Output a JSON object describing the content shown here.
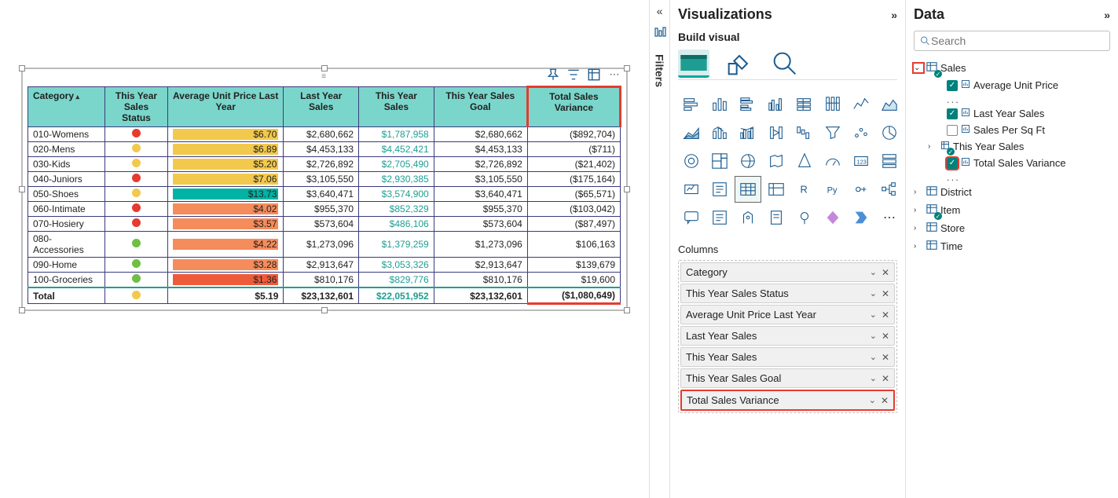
{
  "panes": {
    "filters_label": "Filters",
    "visualizations_title": "Visualizations",
    "build_visual": "Build visual",
    "columns_section": "Columns",
    "data_title": "Data",
    "search_placeholder": "Search"
  },
  "table": {
    "headers": [
      "Category",
      "This Year Sales Status",
      "Average Unit Price Last Year",
      "Last Year Sales",
      "This Year Sales",
      "This Year Sales Goal",
      "Total Sales Variance"
    ],
    "rows": [
      {
        "cat": "010-Womens",
        "status": "red",
        "priceColor": "#f2c94c",
        "price": "$6.70",
        "ly": "$2,680,662",
        "ty": "$1,787,958",
        "goal": "$2,680,662",
        "var": "($892,704)"
      },
      {
        "cat": "020-Mens",
        "status": "yellow",
        "priceColor": "#f2c94c",
        "price": "$6.89",
        "ly": "$4,453,133",
        "ty": "$4,452,421",
        "goal": "$4,453,133",
        "var": "($711)"
      },
      {
        "cat": "030-Kids",
        "status": "yellow",
        "priceColor": "#f2c94c",
        "price": "$5.20",
        "ly": "$2,726,892",
        "ty": "$2,705,490",
        "goal": "$2,726,892",
        "var": "($21,402)"
      },
      {
        "cat": "040-Juniors",
        "status": "red",
        "priceColor": "#f2c94c",
        "price": "$7.06",
        "ly": "$3,105,550",
        "ty": "$2,930,385",
        "goal": "$3,105,550",
        "var": "($175,164)"
      },
      {
        "cat": "050-Shoes",
        "status": "yellow",
        "priceColor": "#00b3a4",
        "price": "$13.73",
        "ly": "$3,640,471",
        "ty": "$3,574,900",
        "goal": "$3,640,471",
        "var": "($65,571)"
      },
      {
        "cat": "060-Intimate",
        "status": "red",
        "priceColor": "#f58c5b",
        "price": "$4.02",
        "ly": "$955,370",
        "ty": "$852,329",
        "goal": "$955,370",
        "var": "($103,042)"
      },
      {
        "cat": "070-Hosiery",
        "status": "red",
        "priceColor": "#f58c5b",
        "price": "$3.57",
        "ly": "$573,604",
        "ty": "$486,106",
        "goal": "$573,604",
        "var": "($87,497)"
      },
      {
        "cat": "080-Accessories",
        "status": "green",
        "priceColor": "#f58c5b",
        "price": "$4.22",
        "ly": "$1,273,096",
        "ty": "$1,379,259",
        "goal": "$1,273,096",
        "var": "$106,163"
      },
      {
        "cat": "090-Home",
        "status": "green",
        "priceColor": "#f58c5b",
        "price": "$3.28",
        "ly": "$2,913,647",
        "ty": "$3,053,326",
        "goal": "$2,913,647",
        "var": "$139,679"
      },
      {
        "cat": "100-Groceries",
        "status": "green",
        "priceColor": "#ee5b3a",
        "price": "$1.36",
        "ly": "$810,176",
        "ty": "$829,776",
        "goal": "$810,176",
        "var": "$19,600"
      }
    ],
    "total": {
      "label": "Total",
      "status": "yellow",
      "price": "$5.19",
      "ly": "$23,132,601",
      "ty": "$22,051,952",
      "goal": "$23,132,601",
      "var": "($1,080,649)"
    }
  },
  "columns_well": [
    {
      "label": "Category",
      "hl": false
    },
    {
      "label": "This Year Sales Status",
      "hl": false
    },
    {
      "label": "Average Unit Price Last Year",
      "hl": false
    },
    {
      "label": "Last Year Sales",
      "hl": false
    },
    {
      "label": "This Year Sales",
      "hl": false
    },
    {
      "label": "This Year Sales Goal",
      "hl": false
    },
    {
      "label": "Total Sales Variance",
      "hl": true
    }
  ],
  "fields": {
    "sales_table": "Sales",
    "avg_unit": "Average Unit Price",
    "ellipsis": "...",
    "last_year": "Last Year Sales",
    "per_sqft": "Sales Per Sq Ft",
    "this_year": "This Year Sales",
    "total_var": "Total Sales Variance",
    "district": "District",
    "item": "Item",
    "store": "Store",
    "time": "Time"
  },
  "chart_data": {
    "type": "table",
    "title": "Sales by Category",
    "columns": [
      "Category",
      "This Year Sales Status",
      "Average Unit Price Last Year",
      "Last Year Sales",
      "This Year Sales",
      "This Year Sales Goal",
      "Total Sales Variance"
    ],
    "data": [
      [
        "010-Womens",
        "red",
        6.7,
        2680662,
        1787958,
        2680662,
        -892704
      ],
      [
        "020-Mens",
        "yellow",
        6.89,
        4453133,
        4452421,
        4453133,
        -711
      ],
      [
        "030-Kids",
        "yellow",
        5.2,
        2726892,
        2705490,
        2726892,
        -21402
      ],
      [
        "040-Juniors",
        "red",
        7.06,
        3105550,
        2930385,
        3105550,
        -175164
      ],
      [
        "050-Shoes",
        "yellow",
        13.73,
        3640471,
        3574900,
        3640471,
        -65571
      ],
      [
        "060-Intimate",
        "red",
        4.02,
        955370,
        852329,
        955370,
        -103042
      ],
      [
        "070-Hosiery",
        "red",
        3.57,
        573604,
        486106,
        573604,
        -87497
      ],
      [
        "080-Accessories",
        "green",
        4.22,
        1273096,
        1379259,
        1273096,
        106163
      ],
      [
        "090-Home",
        "green",
        3.28,
        2913647,
        3053326,
        2913647,
        139679
      ],
      [
        "100-Groceries",
        "green",
        1.36,
        810176,
        829776,
        810176,
        19600
      ]
    ],
    "totals": [
      "Total",
      "yellow",
      5.19,
      23132601,
      22051952,
      23132601,
      -1080649
    ]
  }
}
